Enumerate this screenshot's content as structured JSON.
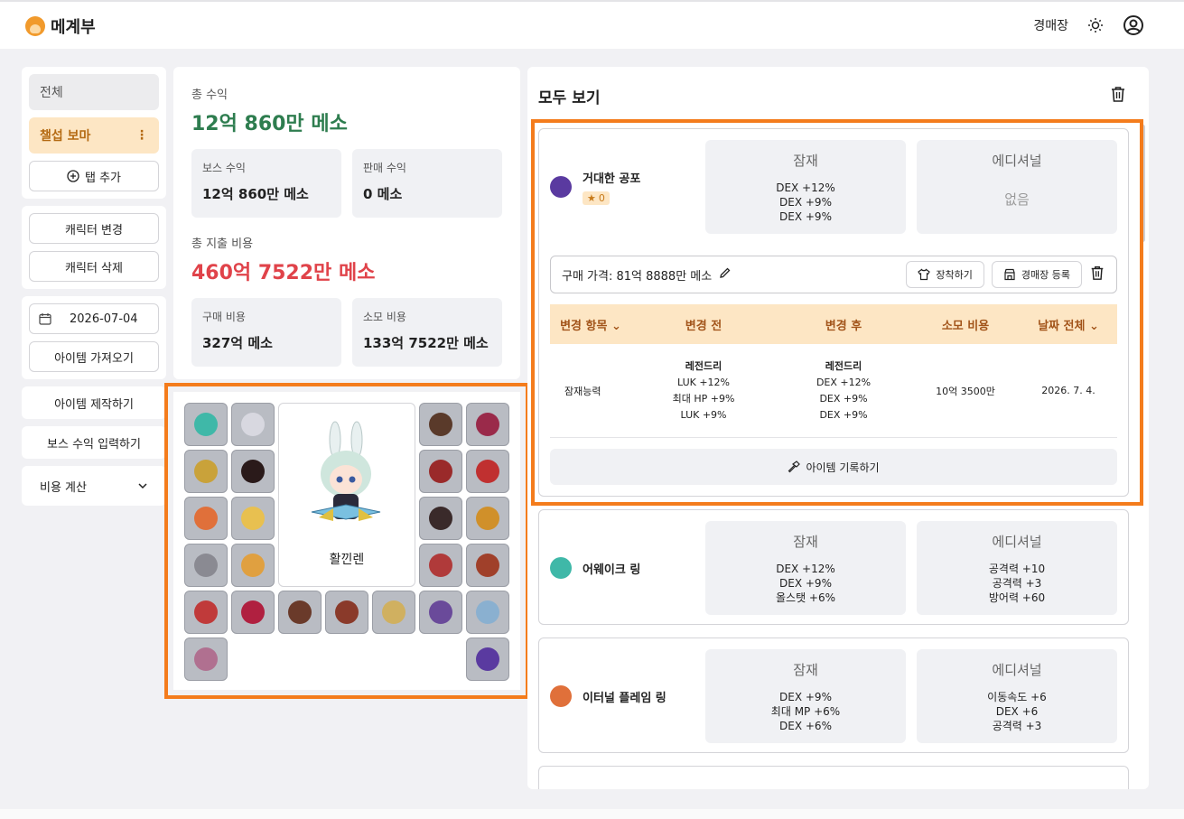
{
  "app": {
    "title": "메계부"
  },
  "top": {
    "auction": "경매장"
  },
  "sidebar": {
    "tab_all": "전체",
    "tab_selected": "챌섭 보마",
    "tab_add": "탭 추가",
    "change_char": "캐릭터 변경",
    "delete_char": "캐릭터 삭제",
    "date": "2026-07-04",
    "fetch_items": "아이템 가져오기",
    "craft": "아이템 제작하기",
    "boss_input": "보스 수익 입력하기",
    "cost_calc": "비용 계산"
  },
  "stats": {
    "total_income_label": "총 수익",
    "total_income": "12억 860만 메소",
    "boss_income_label": "보스 수익",
    "boss_income": "12억 860만 메소",
    "sale_income_label": "판매 수익",
    "sale_income": "0 메소",
    "total_cost_label": "총 지출 비용",
    "total_cost": "460억 7522만 메소",
    "purchase_label": "구매 비용",
    "purchase": "327억 메소",
    "consume_label": "소모 비용",
    "consume": "133억 7522만 메소"
  },
  "character": {
    "name": "활낀렌"
  },
  "equip_colors": [
    "#3fb8a8",
    "#d8d8e0",
    "#5a3a2a",
    "#9a2a4a",
    "#c9a23a",
    "#2a1a1a",
    "#9a2a2a",
    "#c03030",
    "#e0703a",
    "#e8c050",
    "#3a2a2a",
    "#d0902a",
    "#8a8a92",
    "#e0a040",
    "#b03a3a",
    "#a0402a",
    "#c03a3a",
    "#b02040",
    "#6a3a2a",
    "#8a3a2a",
    "#d0b060",
    "#6a4a9a",
    "#8ab0d0",
    "#b07090",
    "#5a3aa0"
  ],
  "items": {
    "title": "모두 보기",
    "list": [
      {
        "name": "거대한 공포",
        "stars": "0",
        "icon_color": "#5a3aa0",
        "potential_label": "잠재",
        "potential": [
          "DEX +12%",
          "DEX +9%",
          "DEX +9%"
        ],
        "additional_label": "에디셔널",
        "additional": [],
        "additional_none": "없음"
      },
      {
        "name": "어웨이크 링",
        "icon_color": "#3fb8a8",
        "potential_label": "잠재",
        "potential": [
          "DEX +12%",
          "DEX +9%",
          "올스탯 +6%"
        ],
        "additional_label": "에디셔널",
        "additional": [
          "공격력 +10",
          "공격력 +3",
          "방어력 +60"
        ]
      },
      {
        "name": "이터널 플레임 링",
        "icon_color": "#e0703a",
        "potential_label": "잠재",
        "potential": [
          "DEX +9%",
          "최대 MP +6%",
          "DEX +6%"
        ],
        "additional_label": "에디셔널",
        "additional": [
          "이동속도 +6",
          "DEX +6",
          "공격력 +3"
        ]
      }
    ],
    "price": "구매 가격: 81억 8888만 메소",
    "equip_btn": "장착하기",
    "auction_btn": "경매장 등록",
    "history": {
      "headers": [
        "변경 항목",
        "변경 전",
        "변경 후",
        "소모 비용",
        "날짜 전체"
      ],
      "row": {
        "item": "잠재능력",
        "before": [
          "레전드리",
          "LUK +12%",
          "최대 HP +9%",
          "LUK +9%"
        ],
        "after": [
          "레전드리",
          "DEX +12%",
          "DEX +9%",
          "DEX +9%"
        ],
        "cost": "10억 3500만",
        "date": "2026. 7. 4."
      }
    },
    "record_btn": "아이템 기록하기"
  }
}
